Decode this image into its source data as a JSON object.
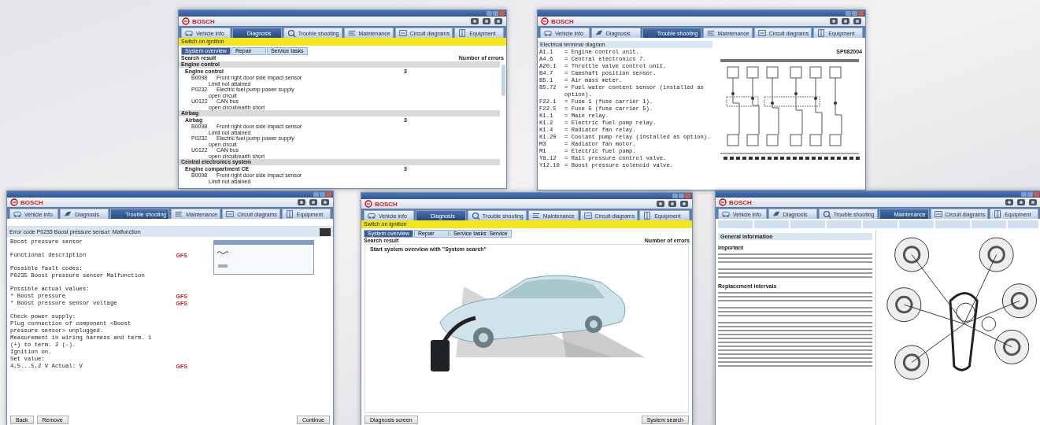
{
  "windows": [
    {
      "kind": "fault-list",
      "brand": "BOSCH",
      "tabs": [
        {
          "label": "Vehicle info",
          "selected": false
        },
        {
          "label": "Diagnosis",
          "selected": true
        },
        {
          "label": "Trouble shooting",
          "selected": false
        },
        {
          "label": "Maintenance",
          "selected": false
        },
        {
          "label": "Circuit diagrams",
          "selected": false
        },
        {
          "label": "Equipment",
          "selected": false
        }
      ],
      "banner": "Switch on ignition",
      "subtabs": [
        {
          "label": "System overview",
          "selected": true
        },
        {
          "label": "Repair",
          "selected": false
        },
        {
          "label": "Service tasks",
          "selected": false
        }
      ],
      "result_label": "Search result",
      "count_heading": "Number of errors",
      "groups": [
        {
          "title": "Engine control",
          "systems": [
            {
              "name": "Engine control",
              "count": "3",
              "faults": [
                {
                  "code": "B0098",
                  "text": "Front right door side impact sensor",
                  "detail": "Limit not attained"
                },
                {
                  "code": "P0232",
                  "text": "Electric fuel pump power supply",
                  "detail": "open circuit"
                },
                {
                  "code": "U0122",
                  "text": "CAN bus",
                  "detail": "open circuit/earth short"
                }
              ]
            }
          ]
        },
        {
          "title": "Airbag",
          "systems": [
            {
              "name": "Airbag",
              "count": "3",
              "faults": [
                {
                  "code": "B0098",
                  "text": "Front right door side impact sensor",
                  "detail": "Limit not attained"
                },
                {
                  "code": "P0232",
                  "text": "Electric fuel pump power supply",
                  "detail": "open circuit"
                },
                {
                  "code": "U0122",
                  "text": "CAN bus",
                  "detail": "open circuit/earth short"
                }
              ]
            }
          ]
        },
        {
          "title": "Central electronics system",
          "systems": [
            {
              "name": "Engine compartment CE",
              "count": "3",
              "faults": [
                {
                  "code": "B0098",
                  "text": "Front right door side impact sensor",
                  "detail": "Limit not attained"
                }
              ]
            }
          ]
        }
      ]
    },
    {
      "kind": "wiring",
      "brand": "BOSCH",
      "tabs": [
        {
          "label": "Vehicle info",
          "selected": false
        },
        {
          "label": "Diagnosis",
          "selected": false
        },
        {
          "label": "Trouble shooting",
          "selected": true
        },
        {
          "label": "Maintenance",
          "selected": false
        },
        {
          "label": "Circuit diagrams",
          "selected": false
        },
        {
          "label": "Equipment",
          "selected": false
        }
      ],
      "panel_title": "Electrical terminal diagram",
      "diagram_id": "SP082004",
      "legend": [
        {
          "code": "A1.1",
          "text": "= Engine control unit."
        },
        {
          "code": "A4.6",
          "text": "= Central electronics 7."
        },
        {
          "code": "A20.1",
          "text": "= Throttle valve control unit."
        },
        {
          "code": "B4.7",
          "text": "= Camshaft position sensor."
        },
        {
          "code": "B5.1",
          "text": "= Air mass meter."
        },
        {
          "code": "B5.72",
          "text": "= Fuel water content sensor (installed as option)."
        },
        {
          "code": "F22.1",
          "text": "= Fuse 1 (fuse carrier 1)."
        },
        {
          "code": "F22.5",
          "text": "= Fuse 5 (fuse carrier 5)."
        },
        {
          "code": "K1.1",
          "text": "= Main relay."
        },
        {
          "code": "K1.2",
          "text": "= Electric fuel pump relay."
        },
        {
          "code": "K1.4",
          "text": "= Radiator fan relay."
        },
        {
          "code": "K1.20",
          "text": "= Coolant pump relay (installed as option)."
        },
        {
          "code": "M3",
          "text": "= Radiator fan motor."
        },
        {
          "code": "M1",
          "text": "= Electric fuel pump."
        },
        {
          "code": "Y8.12",
          "text": "= Rail pressure control valve."
        },
        {
          "code": "Y12.10",
          "text": "= Boost pressure solenoid valve."
        }
      ]
    },
    {
      "kind": "procedure",
      "brand": "BOSCH",
      "tabs": [
        {
          "label": "Vehicle info",
          "selected": false
        },
        {
          "label": "Diagnosis",
          "selected": false
        },
        {
          "label": "Trouble shooting",
          "selected": true
        },
        {
          "label": "Maintenance",
          "selected": false
        },
        {
          "label": "Circuit diagrams",
          "selected": false
        },
        {
          "label": "Equipment",
          "selected": false
        }
      ],
      "error_title": "Error code P0235 Boost pressure sensor: Malfunction",
      "blocks": [
        [
          {
            "text": "Boost pressure sensor"
          }
        ],
        [
          {
            "text": "Functional description",
            "flag": "GFS"
          }
        ],
        [
          {
            "text": "Possible fault codes:"
          },
          {
            "text": "P0235 Boost pressure sensor Malfunction"
          }
        ],
        [
          {
            "text": "Possible actual values:"
          },
          {
            "text": "*   Boost pressure",
            "flag": "GFS"
          },
          {
            "text": "*   Boost pressure sensor voltage",
            "flag": "GFS"
          }
        ],
        [
          {
            "text": "Check power supply:"
          },
          {
            "text": "Plug connection of component <Boost"
          },
          {
            "text": "pressure sensor> unplugged."
          },
          {
            "text": "Measurement in wiring harness and term. 1"
          },
          {
            "text": "(+) to term. 2 (-)."
          },
          {
            "text": "Ignition on."
          },
          {
            "text": "Set value:"
          },
          {
            "text": "4,5...5,2 V Actual: V",
            "flag": "GFS"
          }
        ]
      ],
      "left_buttons": [
        "Back",
        "Remove"
      ],
      "right_button": "Continue"
    },
    {
      "kind": "overview",
      "brand": "BOSCH",
      "tabs": [
        {
          "label": "Vehicle info",
          "selected": false
        },
        {
          "label": "Diagnosis",
          "selected": true
        },
        {
          "label": "Trouble shooting",
          "selected": false
        },
        {
          "label": "Maintenance",
          "selected": false
        },
        {
          "label": "Circuit diagrams",
          "selected": false
        },
        {
          "label": "Equipment",
          "selected": false
        }
      ],
      "banner": "Switch on ignition",
      "subtabs": [
        {
          "label": "System overview",
          "selected": true
        },
        {
          "label": "Repair",
          "selected": false
        },
        {
          "label": "Service tasks: Service",
          "selected": false
        }
      ],
      "result_label": "Search result",
      "count_heading": "Number of errors",
      "prompt": "Start system overview with \"System search\"",
      "left_button": "Diagnosis screen",
      "right_button": "System search"
    },
    {
      "kind": "maintenance",
      "brand": "BOSCH",
      "tabs": [
        {
          "label": "Vehicle info",
          "selected": false
        },
        {
          "label": "Diagnosis",
          "selected": false
        },
        {
          "label": "Trouble shooting",
          "selected": false
        },
        {
          "label": "Maintenance",
          "selected": true
        },
        {
          "label": "Circuit diagrams",
          "selected": false
        },
        {
          "label": "Equipment",
          "selected": false
        }
      ],
      "section_title": "General information",
      "sections": [
        "Important",
        "Replacement intervals"
      ]
    }
  ]
}
